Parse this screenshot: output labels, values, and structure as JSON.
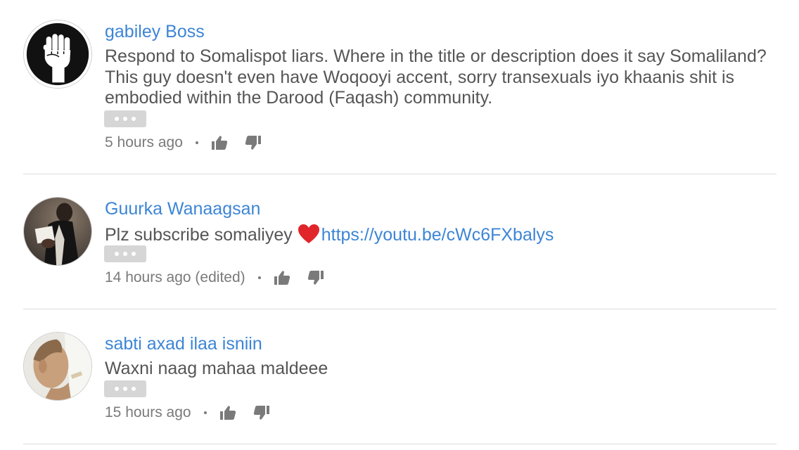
{
  "comments": [
    {
      "author": "gabiley Boss",
      "text": "Respond to Somalispot liars. Where in the title or description does it say Somaliland? This guy doesn't even have Woqooyi accent, sorry transexuals iyo khaanis shit is embodied within the Darood (Faqash) community.",
      "time": "5 hours ago",
      "avatar_icon": "raised-fist-icon"
    },
    {
      "author": "Guurka Wanaagsan",
      "text_before": "Plz subscribe somaliyey",
      "emoji": "red-heart-icon",
      "link": "https://youtu.be/cWc6FXbalys",
      "time": "14 hours ago (edited)"
    },
    {
      "author": "sabti axad ilaa isniin",
      "text": "Waxni naag mahaa maldeee",
      "time": "15 hours ago"
    }
  ],
  "colors": {
    "author": "#3d85d6",
    "link": "#3d85d6",
    "text": "#555555",
    "meta": "#7a7a7a",
    "more_button": "#d6d6d6",
    "divider": "#dcdcdc",
    "heart": "#e0262b"
  }
}
